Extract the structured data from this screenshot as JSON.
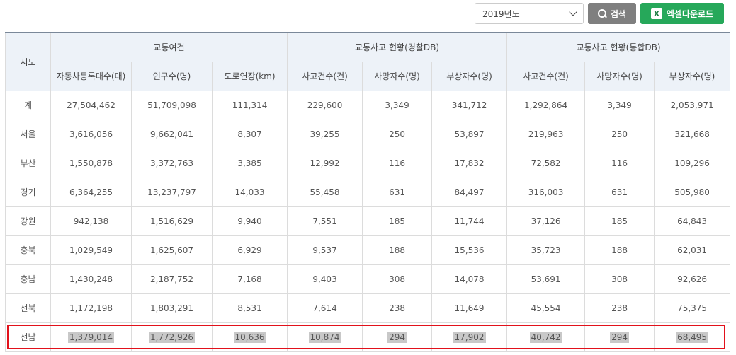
{
  "toolbar": {
    "year_selected": "2019년도",
    "search_label": "검색",
    "excel_label": "엑셀다운로드",
    "excel_icon_letter": "X"
  },
  "table": {
    "region_header": "시도",
    "groups": [
      "교통여건",
      "교통사고 현황(경찰DB)",
      "교통사고 현황(통합DB)"
    ],
    "columns": [
      "자동차등록대수(대)",
      "인구수(명)",
      "도로연장(km)",
      "사고건수(건)",
      "사망자수(명)",
      "부상자수(명)",
      "사고건수(건)",
      "사망자수(명)",
      "부상자수(명)"
    ],
    "rows": [
      {
        "region": "계",
        "values": [
          "27,504,462",
          "51,709,098",
          "111,314",
          "229,600",
          "3,349",
          "341,712",
          "1,292,864",
          "3,349",
          "2,053,971"
        ]
      },
      {
        "region": "서울",
        "values": [
          "3,616,056",
          "9,662,041",
          "8,307",
          "39,255",
          "250",
          "53,897",
          "219,963",
          "250",
          "321,668"
        ]
      },
      {
        "region": "부산",
        "values": [
          "1,550,878",
          "3,372,763",
          "3,385",
          "12,992",
          "116",
          "17,832",
          "72,582",
          "116",
          "109,296"
        ]
      },
      {
        "region": "경기",
        "values": [
          "6,364,255",
          "13,237,797",
          "14,033",
          "55,458",
          "631",
          "84,497",
          "316,003",
          "631",
          "505,980"
        ]
      },
      {
        "region": "강원",
        "values": [
          "942,138",
          "1,516,629",
          "9,940",
          "7,551",
          "185",
          "11,744",
          "37,126",
          "185",
          "64,843"
        ]
      },
      {
        "region": "충북",
        "values": [
          "1,029,549",
          "1,625,607",
          "6,929",
          "9,537",
          "188",
          "15,536",
          "35,723",
          "188",
          "62,031"
        ]
      },
      {
        "region": "충남",
        "values": [
          "1,430,248",
          "2,187,752",
          "7,168",
          "9,403",
          "308",
          "14,078",
          "53,691",
          "308",
          "92,626"
        ]
      },
      {
        "region": "전북",
        "values": [
          "1,172,198",
          "1,803,291",
          "8,531",
          "7,614",
          "238",
          "11,649",
          "45,554",
          "238",
          "75,375"
        ]
      },
      {
        "region": "전남",
        "values": [
          "1,379,014",
          "1,772,926",
          "10,636",
          "10,874",
          "294",
          "17,902",
          "40,742",
          "294",
          "68,495"
        ]
      }
    ],
    "selected_row": 8
  }
}
